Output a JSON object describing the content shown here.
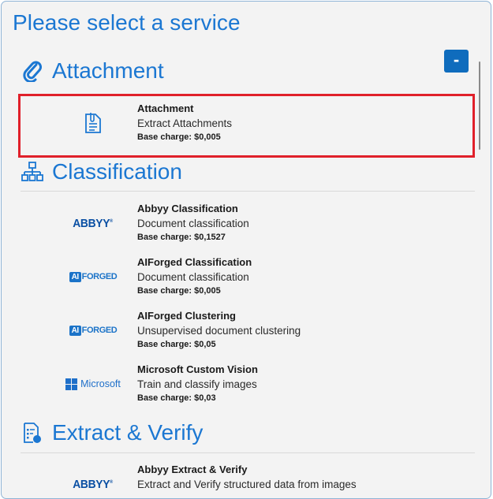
{
  "title": "Please select a service",
  "collapse_label": "-",
  "accent": "#1b77d2",
  "selection_color": "#e0202a",
  "sections": [
    {
      "title": "Attachment",
      "icon": "paperclip-icon",
      "services": [
        {
          "name": "Attachment",
          "description": "Extract Attachments",
          "charge": "Base charge: $0,005",
          "logo": "document-clip-icon"
        }
      ]
    },
    {
      "title": "Classification",
      "icon": "hierarchy-icon",
      "services": [
        {
          "name": "Abbyy Classification",
          "description": "Document classification",
          "charge": "Base charge: $0,1527",
          "logo": "ABBYY"
        },
        {
          "name": "AIForged Classification",
          "description": "Document classification",
          "charge": "Base charge: $0,005",
          "logo": "AIFORGED"
        },
        {
          "name": "AIForged Clustering",
          "description": "Unsupervised document clustering",
          "charge": "Base charge: $0,05",
          "logo": "AIFORGED"
        },
        {
          "name": "Microsoft Custom Vision",
          "description": "Train and classify images",
          "charge": "Base charge: $0,03",
          "logo": "Microsoft"
        }
      ]
    },
    {
      "title": "Extract & Verify",
      "icon": "document-list-icon",
      "services": [
        {
          "name": "Abbyy Extract & Verify",
          "description": "Extract and Verify structured data from images",
          "charge": "",
          "logo": "ABBYY"
        }
      ]
    }
  ],
  "logo_text": {
    "abbyy": "ABBYY",
    "abbyy_mark": "®",
    "aiforged_box": "AI",
    "aiforged_word": "FORGED",
    "microsoft": "Microsoft"
  }
}
